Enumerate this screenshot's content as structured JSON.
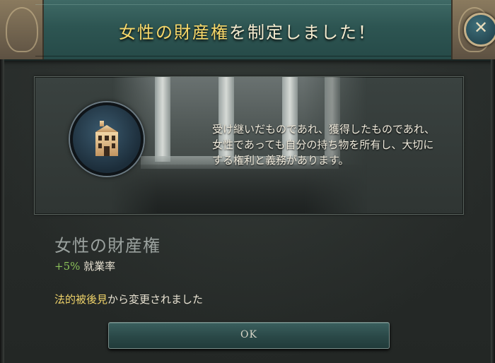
{
  "header": {
    "title_highlight": "女性の財産権",
    "title_rest": "を制定しました！",
    "close_icon": "close-icon"
  },
  "event": {
    "icon": "building-icon",
    "description": "受け継いだものであれ、獲得したものであれ、女性であっても自分の持ち物を所有し、大切にする権利と義務があります。"
  },
  "law": {
    "name": "女性の財産権",
    "effect_value": "+5%",
    "effect_label": "就業率",
    "change_from": "法的被後見",
    "change_suffix": "から変更されました"
  },
  "buttons": {
    "ok_label": "OK"
  },
  "colors": {
    "title_highlight": "#f7d86a",
    "positive_effect": "#8cc25a",
    "header_bg": "#2d5552"
  }
}
